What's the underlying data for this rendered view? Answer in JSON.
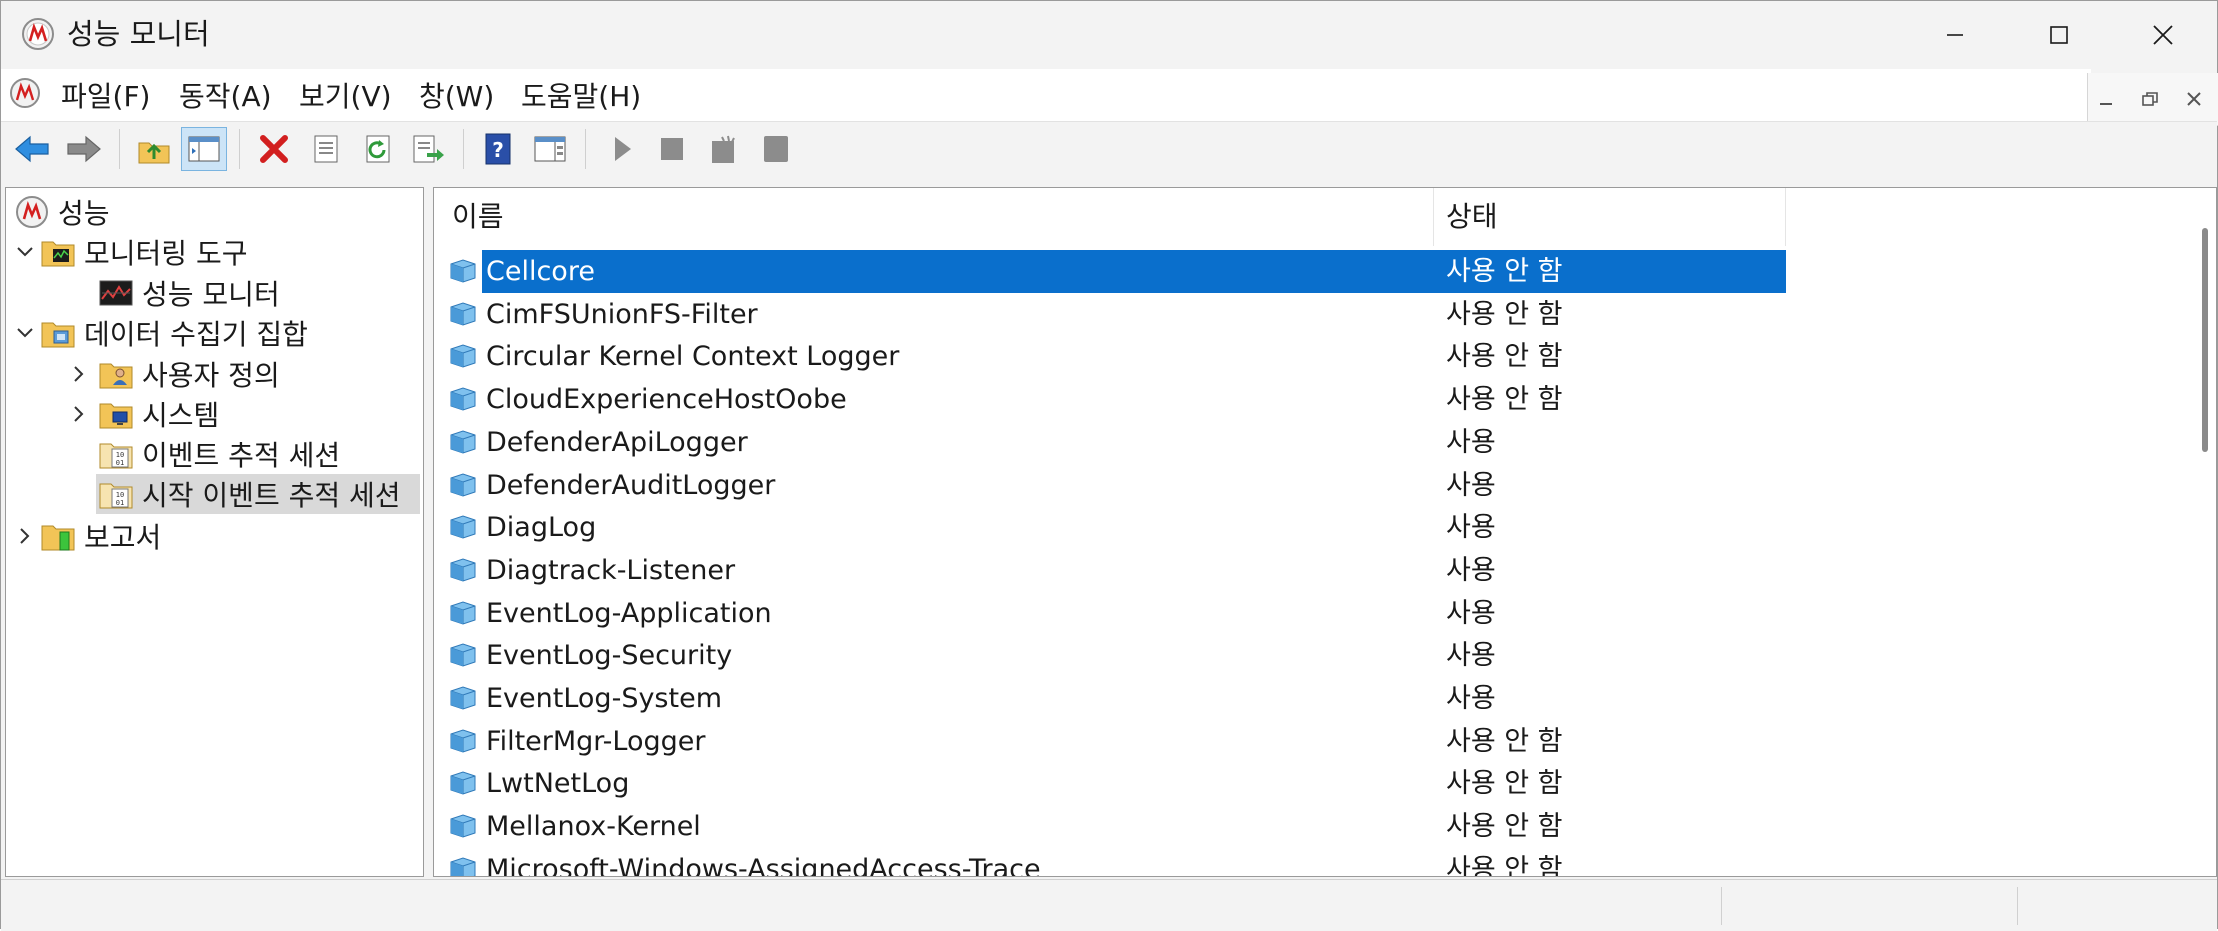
{
  "window": {
    "title": "성능 모니터",
    "minimize_icon": "minimize-icon",
    "maximize_icon": "maximize-icon",
    "close_icon": "close-icon"
  },
  "menu": [
    {
      "label": "파일(F)"
    },
    {
      "label": "동작(A)"
    },
    {
      "label": "보기(V)"
    },
    {
      "label": "창(W)"
    },
    {
      "label": "도움말(H)"
    }
  ],
  "toolbar": {
    "buttons": [
      "back-icon",
      "forward-icon",
      "up-folder-icon",
      "show-hide-tree-icon",
      "delete-icon",
      "properties-icon",
      "refresh-icon",
      "export-list-icon",
      "help-icon",
      "show-hide-action-pane-icon",
      "start-icon",
      "stop-icon",
      "new-data-collector-icon",
      "stop-all-icon"
    ]
  },
  "tree": {
    "root": "성능",
    "monitoring_tools": "모니터링 도구",
    "performance_monitor": "성능 모니터",
    "data_collector_sets": "데이터 수집기 집합",
    "user_defined": "사용자 정의",
    "system": "시스템",
    "event_trace_sessions": "이벤트 추적 세션",
    "startup_event_trace_sessions": "시작 이벤트 추적 세션",
    "reports": "보고서"
  },
  "list": {
    "col_name": "이름",
    "col_status": "상태",
    "rows": [
      {
        "name": "Cellcore",
        "status": "사용 안 함",
        "selected": true
      },
      {
        "name": "CimFSUnionFS-Filter",
        "status": "사용 안 함"
      },
      {
        "name": "Circular Kernel Context Logger",
        "status": "사용 안 함"
      },
      {
        "name": "CloudExperienceHostOobe",
        "status": "사용 안 함"
      },
      {
        "name": "DefenderApiLogger",
        "status": "사용"
      },
      {
        "name": "DefenderAuditLogger",
        "status": "사용"
      },
      {
        "name": "DiagLog",
        "status": "사용"
      },
      {
        "name": "Diagtrack-Listener",
        "status": "사용"
      },
      {
        "name": "EventLog-Application",
        "status": "사용"
      },
      {
        "name": "EventLog-Security",
        "status": "사용"
      },
      {
        "name": "EventLog-System",
        "status": "사용"
      },
      {
        "name": "FilterMgr-Logger",
        "status": "사용 안 함"
      },
      {
        "name": "LwtNetLog",
        "status": "사용 안 함"
      },
      {
        "name": "Mellanox-Kernel",
        "status": "사용 안 함"
      },
      {
        "name": "Microsoft-Windows-AssignedAccess-Trace",
        "status": "사용 안 함"
      }
    ]
  },
  "colors": {
    "selection": "#0a6fcc",
    "tree_selection": "#d9d9d9",
    "background": "#f3f3f3"
  }
}
